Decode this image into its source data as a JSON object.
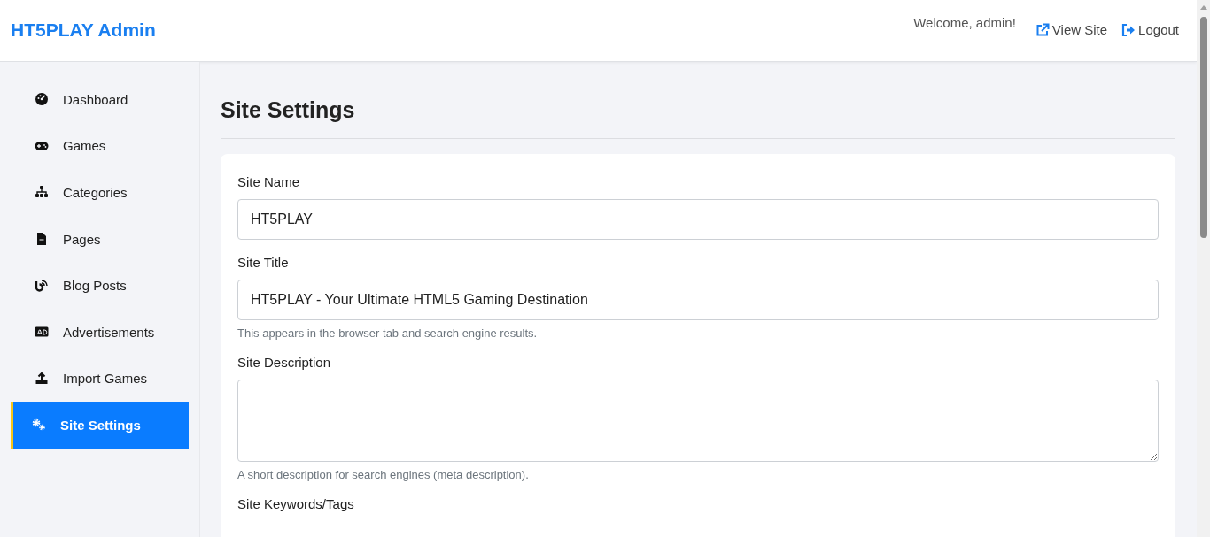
{
  "header": {
    "brand": "HT5PLAY Admin",
    "welcome": "Welcome, admin!",
    "links": [
      {
        "kind": "external",
        "label": "View Site"
      },
      {
        "kind": "logout",
        "label": "Logout"
      }
    ]
  },
  "sidebar": {
    "items": [
      {
        "kind": "dashboard",
        "label": "Dashboard",
        "selected": false
      },
      {
        "kind": "games",
        "label": "Games",
        "selected": false
      },
      {
        "kind": "categories",
        "label": "Categories",
        "selected": false
      },
      {
        "kind": "pages",
        "label": "Pages",
        "selected": false
      },
      {
        "kind": "blog",
        "label": "Blog Posts",
        "selected": false
      },
      {
        "kind": "ads",
        "label": "Advertisements",
        "selected": false
      },
      {
        "kind": "import",
        "label": "Import Games",
        "selected": false
      },
      {
        "kind": "settings",
        "label": "Site Settings",
        "selected": true
      }
    ]
  },
  "page": {
    "title": "Site Settings"
  },
  "form": {
    "fields": [
      {
        "kind": "text",
        "label": "Site Name",
        "value": "HT5PLAY"
      },
      {
        "kind": "text",
        "label": "Site Title",
        "value": "HT5PLAY - Your Ultimate HTML5 Gaming Destination",
        "help": "This appears in the browser tab and search engine results."
      },
      {
        "kind": "textarea",
        "label": "Site Description",
        "help": "A short description for search engines (meta description)."
      },
      {
        "kind": "cut",
        "label": "Site Keywords/Tags"
      }
    ]
  }
}
